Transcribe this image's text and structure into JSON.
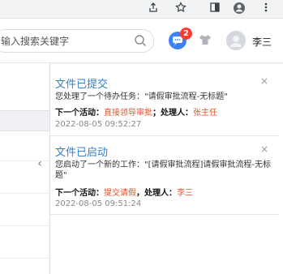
{
  "search": {
    "placeholder": "输入搜索关键字"
  },
  "header": {
    "badge_count": "2",
    "username": "李三"
  },
  "notifications": [
    {
      "title": "文件已提交",
      "close": "×",
      "body": "您处理了一个待办任务：\"请假审批流程-无标题\"",
      "next_label": "下一个活动：",
      "next_value": "直接领导审批",
      "sep": "；",
      "handler_label": "处理人：",
      "handler_value": "张主任",
      "time": "2022-08-05 09:52:27"
    },
    {
      "title": "文件已启动",
      "close": "×",
      "body": "您启动了一个新的工作：\"[请假审批流程]请假审批流程-无标题\"",
      "next_label": "下一个活动：",
      "next_value": "提交请假",
      "sep": "，",
      "handler_label": "处理人：",
      "handler_value": "李三",
      "time": "2022-08-05 09:51:24"
    }
  ],
  "colors": {
    "link": "#2f7fd1",
    "accent": "#e0562c",
    "badge": "#ff3b30",
    "chat": "#3b82f6"
  }
}
